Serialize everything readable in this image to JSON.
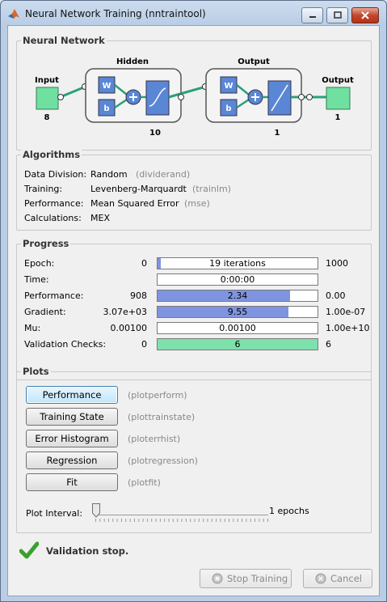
{
  "window": {
    "title": "Neural Network Training (nntraintool)"
  },
  "network": {
    "group_label": "Neural Network",
    "input_label": "Input",
    "input_size": "8",
    "hidden_label": "Hidden",
    "hidden_size": "10",
    "output_layer_label": "Output",
    "output_layer_size": "1",
    "output_label": "Output",
    "output_size": "1",
    "weight_glyph": "W",
    "bias_glyph": "b"
  },
  "algorithms": {
    "group_label": "Algorithms",
    "rows": [
      {
        "label": "Data Division:",
        "value": "Random",
        "fn": "(dividerand)"
      },
      {
        "label": "Training:",
        "value": "Levenberg-Marquardt",
        "fn": "(trainlm)"
      },
      {
        "label": "Performance:",
        "value": "Mean Squared Error",
        "fn": "(mse)"
      },
      {
        "label": "Calculations:",
        "value": "MEX",
        "fn": ""
      }
    ]
  },
  "progress": {
    "group_label": "Progress",
    "rows": [
      {
        "label": "Epoch:",
        "start": "0",
        "bar_text": "19 iterations",
        "end": "1000",
        "fill_fraction": 0.02,
        "fill_color": "#7f94e0"
      },
      {
        "label": "Time:",
        "start": "",
        "bar_text": "0:00:00",
        "end": "",
        "fill_fraction": 0,
        "fill_color": "#7f94e0"
      },
      {
        "label": "Performance:",
        "start": "908",
        "bar_text": "2.34",
        "end": "0.00",
        "fill_fraction": 0.83,
        "fill_color": "#7f94e0"
      },
      {
        "label": "Gradient:",
        "start": "3.07e+03",
        "bar_text": "9.55",
        "end": "1.00e-07",
        "fill_fraction": 0.82,
        "fill_color": "#7f94e0"
      },
      {
        "label": "Mu:",
        "start": "0.00100",
        "bar_text": "0.00100",
        "end": "1.00e+10",
        "fill_fraction": 0,
        "fill_color": "#7f94e0"
      },
      {
        "label": "Validation Checks:",
        "start": "0",
        "bar_text": "6",
        "end": "6",
        "fill_fraction": 1.0,
        "fill_color": "#7ee0ab"
      }
    ]
  },
  "plots": {
    "group_label": "Plots",
    "buttons": [
      {
        "label": "Performance",
        "fn": "(plotperform)"
      },
      {
        "label": "Training State",
        "fn": "(plottrainstate)"
      },
      {
        "label": "Error Histogram",
        "fn": "(ploterrhist)"
      },
      {
        "label": "Regression",
        "fn": "(plotregression)"
      },
      {
        "label": "Fit",
        "fn": "(plotfit)"
      }
    ],
    "interval_label": "Plot Interval:",
    "interval_value": "1 epochs"
  },
  "status": {
    "text": "Validation stop.",
    "icon": "checkmark-icon",
    "color": "#3aa02e"
  },
  "footer": {
    "stop_label": "Stop Training",
    "cancel_label": "Cancel"
  }
}
